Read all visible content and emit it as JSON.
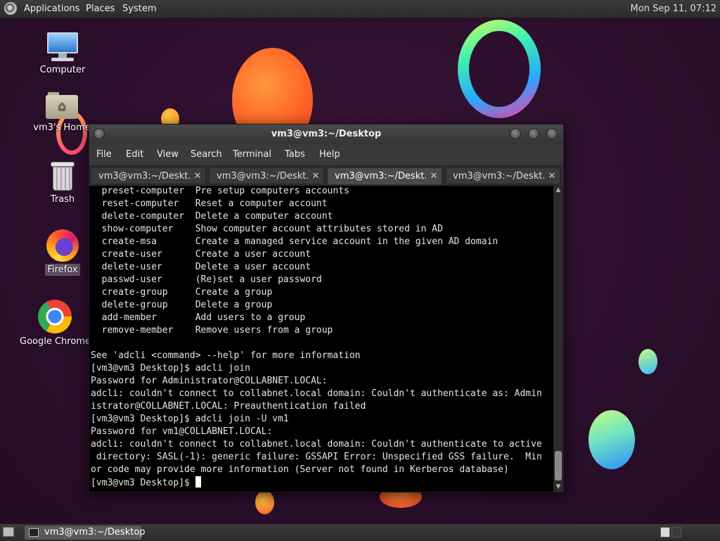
{
  "top_panel": {
    "menus": [
      "Applications",
      "Places",
      "System"
    ],
    "clock": "Mon Sep 11, 07:12"
  },
  "desktop_icons": [
    {
      "label": "Computer",
      "icon": "computer-icon"
    },
    {
      "label": "vm3's Home",
      "icon": "home-folder-icon"
    },
    {
      "label": "Trash",
      "icon": "trash-icon"
    },
    {
      "label": "Firefox",
      "icon": "firefox-icon"
    },
    {
      "label": "Google Chrome",
      "icon": "chrome-icon"
    }
  ],
  "window": {
    "title": "vm3@vm3:~/Desktop",
    "menu": [
      "File",
      "Edit",
      "View",
      "Search",
      "Terminal",
      "Tabs",
      "Help"
    ],
    "tabs": [
      {
        "label": "vm3@vm3:~/Deskt…",
        "active": false
      },
      {
        "label": "vm3@vm3:~/Deskt…",
        "active": false
      },
      {
        "label": "vm3@vm3:~/Deskt…",
        "active": true
      },
      {
        "label": "vm3@vm3:~/Deskt…",
        "active": false
      }
    ],
    "tab_close": "✕",
    "terminal_lines": [
      "  preset-computer  Pre setup computers accounts",
      "  reset-computer   Reset a computer account",
      "  delete-computer  Delete a computer account",
      "  show-computer    Show computer account attributes stored in AD",
      "  create-msa       Create a managed service account in the given AD domain",
      "  create-user      Create a user account",
      "  delete-user      Delete a user account",
      "  passwd-user      (Re)set a user password",
      "  create-group     Create a group",
      "  delete-group     Delete a group",
      "  add-member       Add users to a group",
      "  remove-member    Remove users from a group",
      "",
      "See 'adcli <command> --help' for more information",
      "[vm3@vm3 Desktop]$ adcli join",
      "Password for Administrator@COLLABNET.LOCAL:",
      "adcli: couldn't connect to collabnet.local domain: Couldn't authenticate as: Admin",
      "istrator@COLLABNET.LOCAL: Preauthentication failed",
      "[vm3@vm3 Desktop]$ adcli join -U vm1",
      "Password for vm1@COLLABNET.LOCAL:",
      "adcli: couldn't connect to collabnet.local domain: Couldn't authenticate to active",
      " directory: SASL(-1): generic failure: GSSAPI Error: Unspecified GSS failure.  Min",
      "or code may provide more information (Server not found in Kerberos database)"
    ],
    "prompt": "[vm3@vm3 Desktop]$ "
  },
  "taskbar": {
    "task_label": "vm3@vm3:~/Desktop"
  }
}
